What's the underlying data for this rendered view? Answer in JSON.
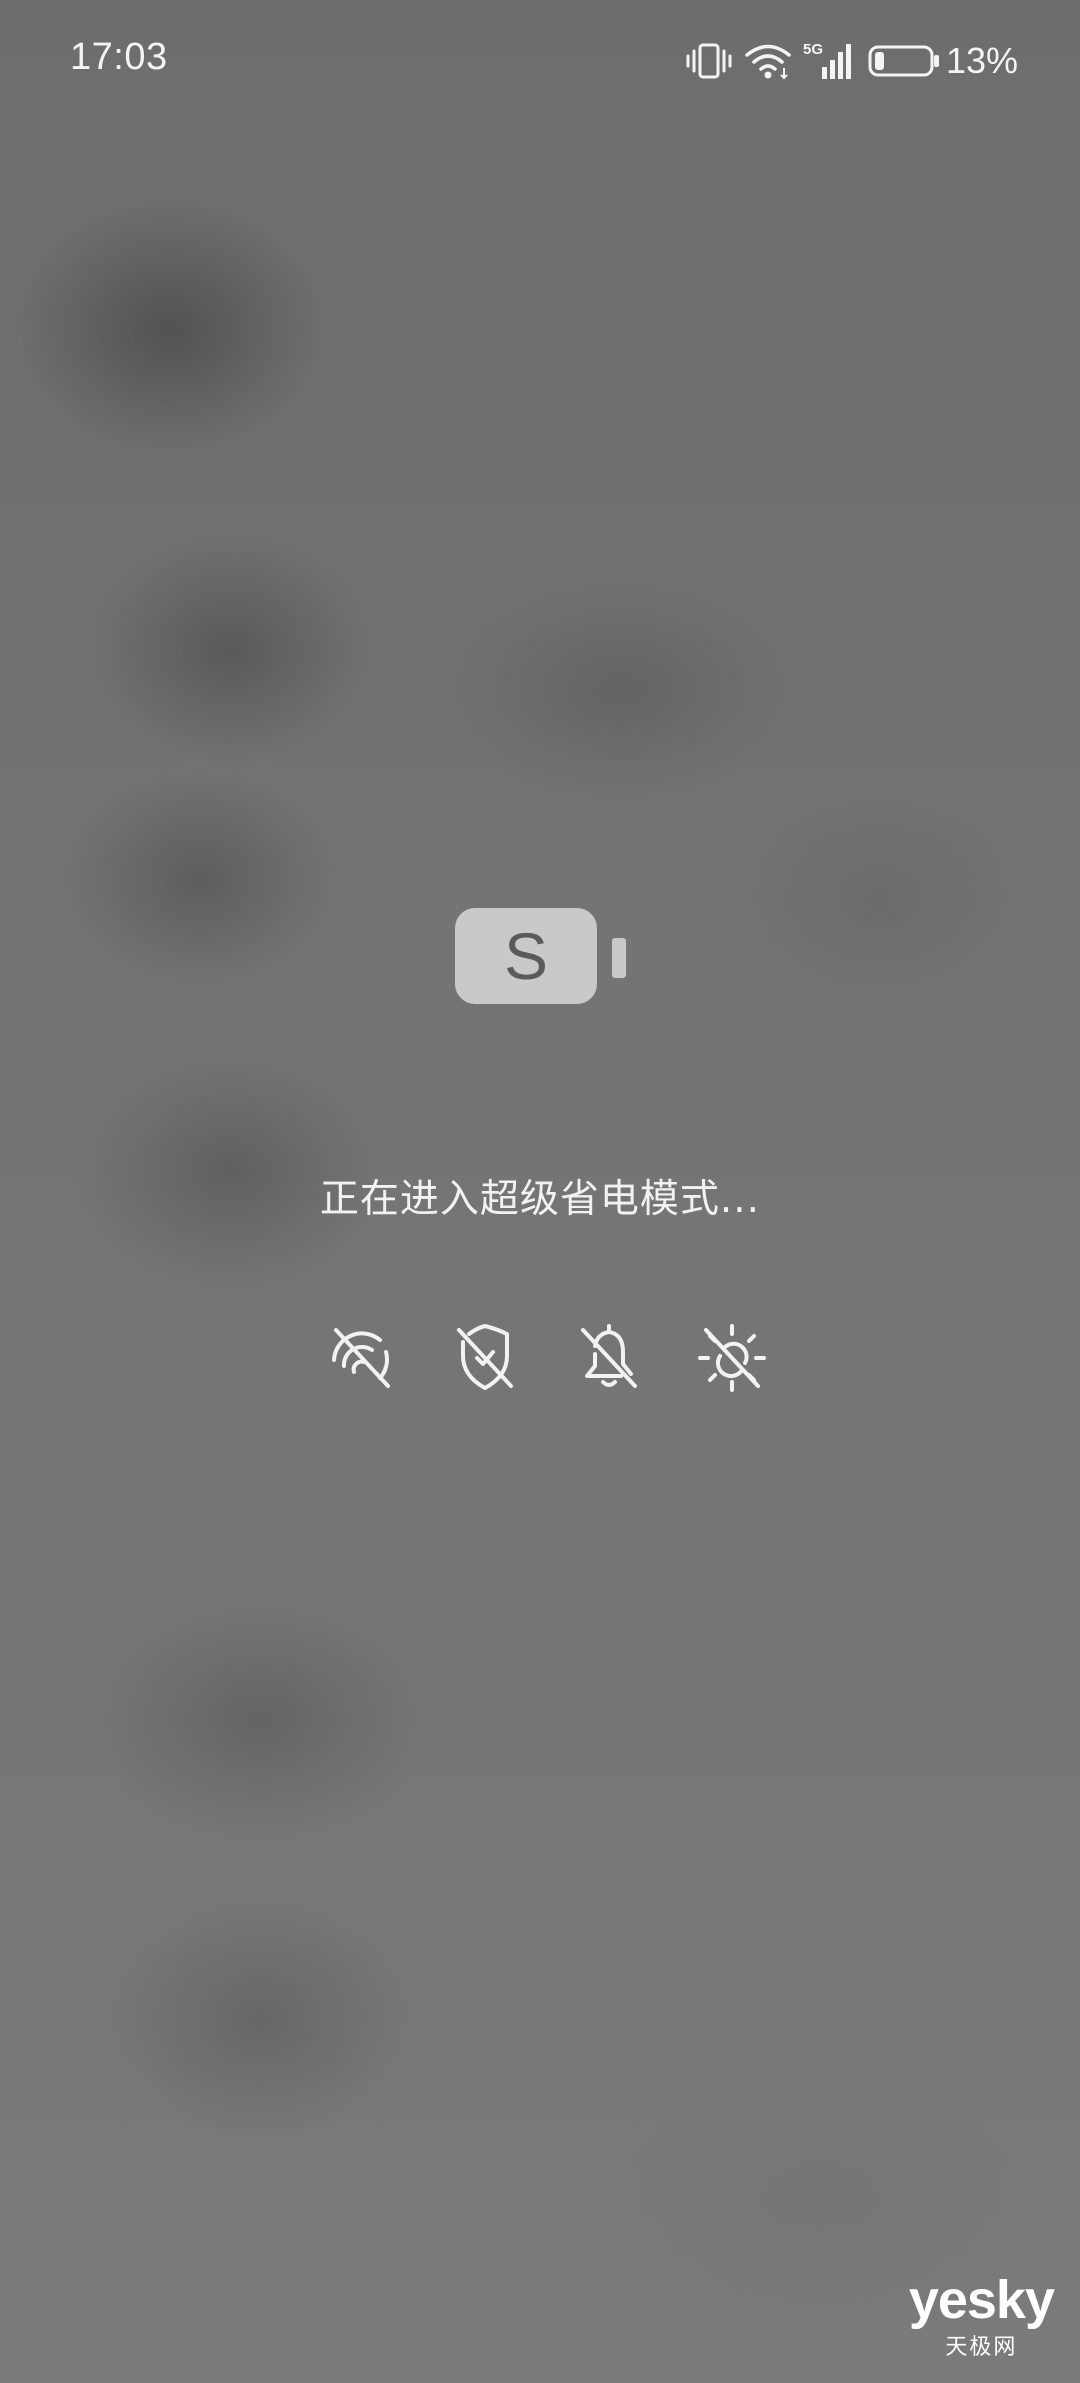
{
  "status_bar": {
    "time": "17:03",
    "battery_percent": "13%",
    "network_type": "5G",
    "battery_level": 0.13,
    "icons": [
      "vibrate-icon",
      "wifi-icon",
      "cellular-5g-icon",
      "battery-icon"
    ]
  },
  "saver": {
    "badge_letter": "S",
    "message": "正在进入超级省电模式...",
    "disabled_features": [
      "location-off-icon",
      "security-off-icon",
      "notifications-off-icon",
      "brightness-off-icon"
    ]
  },
  "watermark": {
    "main": "yesky",
    "sub": "天极网"
  },
  "colors": {
    "background": "#727272",
    "badge": "#c9c9c9",
    "badge_letter": "#5b5b5b",
    "foreground": "#f2f2f2"
  }
}
